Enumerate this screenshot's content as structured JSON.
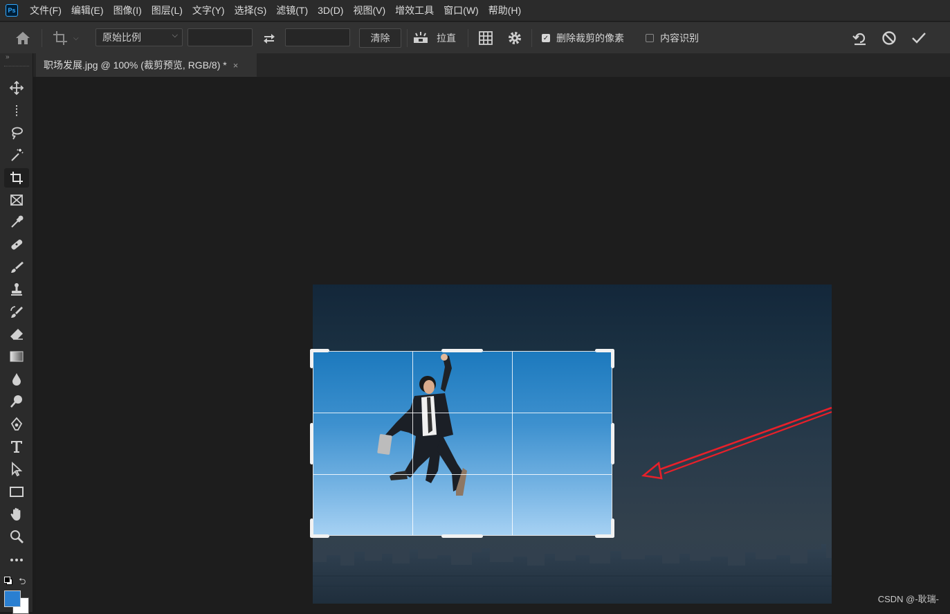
{
  "app": {
    "logo_text": "Ps"
  },
  "menu": [
    "文件(F)",
    "编辑(E)",
    "图像(I)",
    "图层(L)",
    "文字(Y)",
    "选择(S)",
    "滤镜(T)",
    "3D(D)",
    "视图(V)",
    "增效工具",
    "窗口(W)",
    "帮助(H)"
  ],
  "options": {
    "ratio_select": "原始比例",
    "width_value": "",
    "height_value": "",
    "clear_label": "清除",
    "straighten_label": "拉直",
    "delete_cropped_label": "删除裁剪的像素",
    "delete_cropped_checked": true,
    "content_aware_label": "内容识别",
    "content_aware_checked": false
  },
  "tools": [
    "move-tool",
    "marquee-tool",
    "lasso-tool",
    "magic-wand-tool",
    "crop-tool",
    "frame-tool",
    "eyedropper-tool",
    "healing-brush-tool",
    "brush-tool",
    "clone-stamp-tool",
    "history-brush-tool",
    "eraser-tool",
    "gradient-tool",
    "blur-tool",
    "dodge-tool",
    "pen-tool",
    "type-tool",
    "path-selection-tool",
    "rectangle-tool",
    "hand-tool",
    "zoom-tool",
    "more-tools"
  ],
  "active_tool": "crop-tool",
  "colors": {
    "foreground": "#2a7fd1",
    "background": "#ffffff",
    "accent": "#e8202a"
  },
  "document": {
    "tab_title": "职场发展.jpg @ 100% (裁剪预览, RGB/8) *",
    "close_glyph": "×"
  },
  "watermark": "CSDN @-耿瑞-"
}
